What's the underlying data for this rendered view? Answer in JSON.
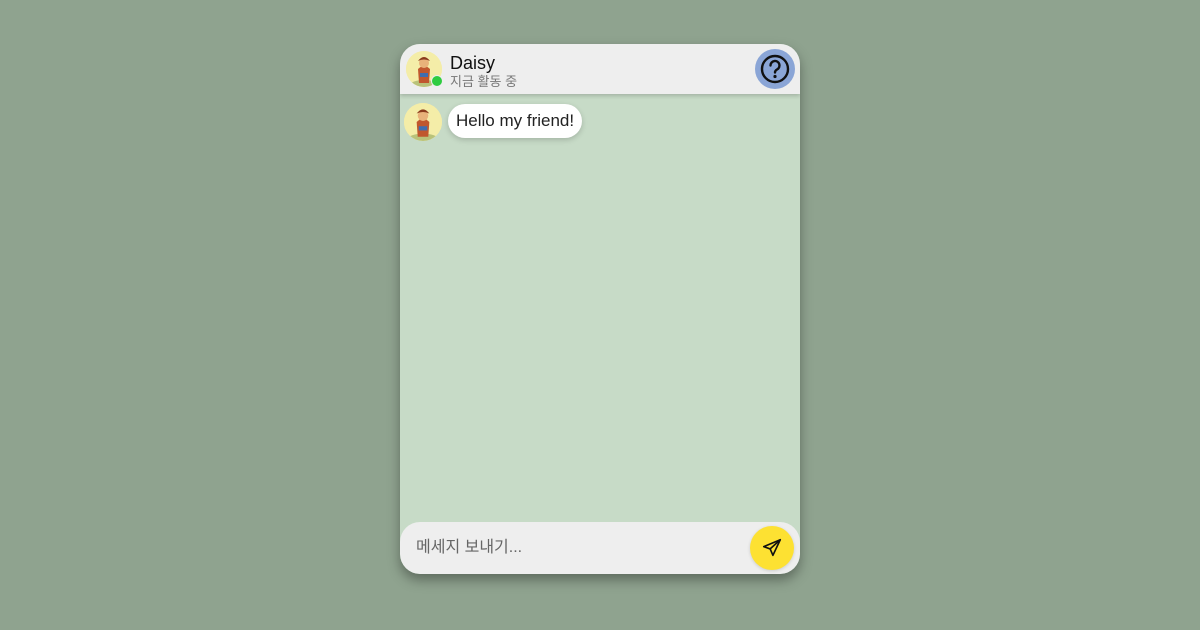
{
  "colors": {
    "page_background": "#8fa38f",
    "chat_background": "#c7dbc7",
    "header_background": "#eeeeee",
    "online_indicator": "#2ecc40",
    "help_button": "#8aa5d6",
    "send_button": "#fde132"
  },
  "header": {
    "contact_name": "Daisy",
    "status_text": "지금 활동 중",
    "online": true,
    "avatar_icon": "cartoon-character-avatar",
    "help_icon": "question-circle-icon"
  },
  "messages": [
    {
      "sender": "Daisy",
      "text": "Hello my friend!"
    }
  ],
  "composer": {
    "placeholder": "메세지 보내기...",
    "value": "",
    "send_icon": "paper-plane-icon"
  }
}
